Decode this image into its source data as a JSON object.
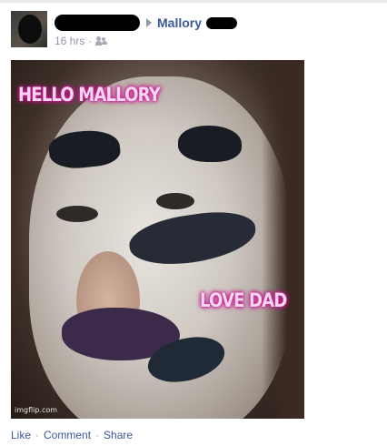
{
  "post": {
    "recipient_name": "Mallory",
    "timestamp": "16 hrs",
    "separator": "·",
    "privacy_icon": "friends-icon",
    "direction_icon": "arrow-right-icon"
  },
  "photo": {
    "caption_top": "HELLO MALLORY",
    "caption_bottom": "LOVE DAD",
    "watermark": "imgflip.com"
  },
  "actions": {
    "like": "Like",
    "comment": "Comment",
    "share": "Share",
    "separator": "·"
  },
  "colors": {
    "link": "#3b5998",
    "meta": "#9197a3",
    "caption_glow": "#e1209f"
  }
}
